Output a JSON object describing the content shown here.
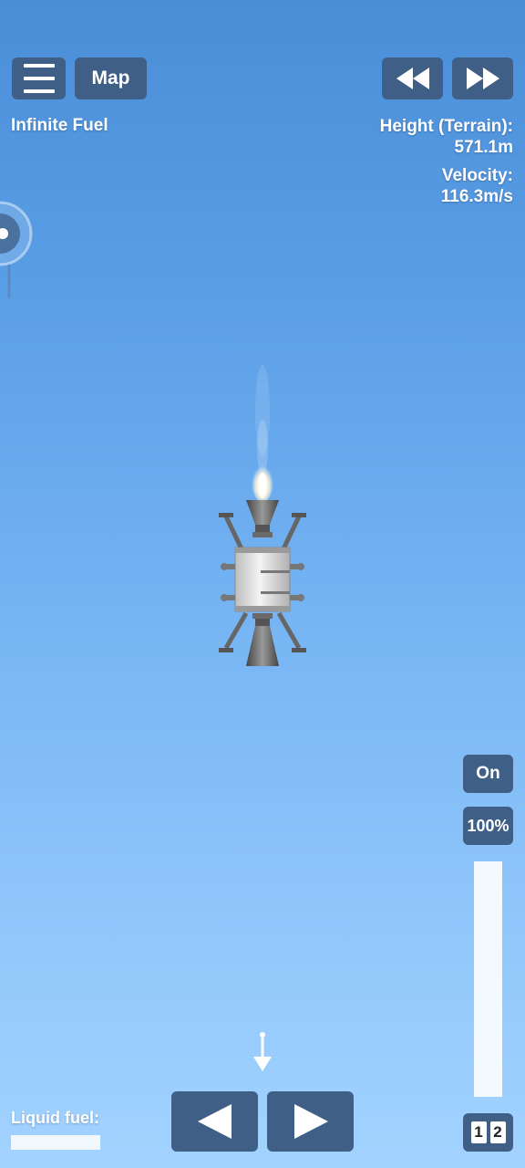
{
  "top_bar": {
    "map_label": "Map",
    "menu_icon": "hamburger-menu-icon",
    "rewind_icon": "rewind-icon",
    "fast_forward_icon": "fast-forward-icon"
  },
  "status": {
    "infinite_fuel": "Infinite Fuel",
    "height_label": "Height (Terrain):",
    "height_value": "571.1m",
    "velocity_label": "Velocity:",
    "velocity_value": "116.3m/s"
  },
  "controls": {
    "engine_toggle": "On",
    "throttle_label": "100%",
    "throttle_level": 1.0,
    "rotate_left_icon": "rotate-left-icon",
    "rotate_right_icon": "rotate-right-icon"
  },
  "fuel": {
    "label": "Liquid fuel:",
    "level": 1.0
  },
  "stages": {
    "stage_1": "1",
    "stage_2": "2"
  }
}
